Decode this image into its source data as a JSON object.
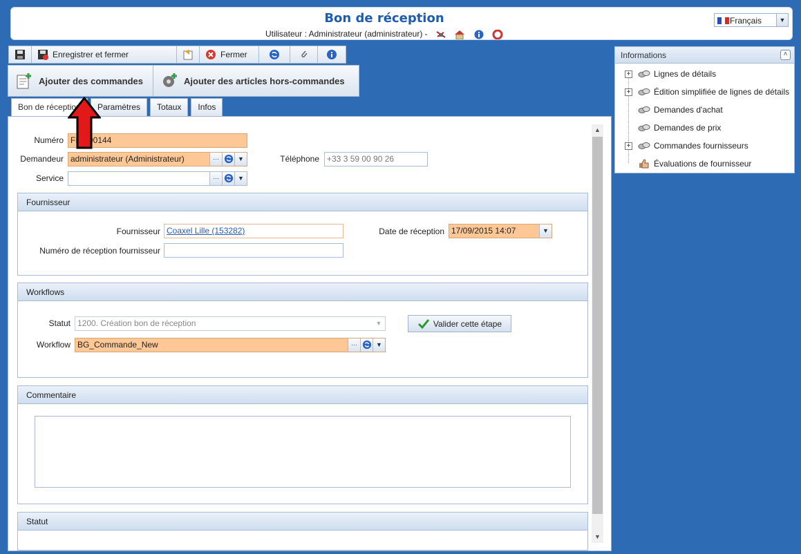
{
  "header": {
    "title": "Bon de réception",
    "user_line": "Utilisateur : Administrateur (administrateur)  -",
    "language": "Français"
  },
  "toolbar1": {
    "save_close": "Enregistrer et fermer",
    "close": "Fermer"
  },
  "toolbar2": {
    "add_orders": "Ajouter des commandes",
    "add_items": "Ajouter des articles hors-commandes"
  },
  "tabs": [
    "Bon de réception",
    "Paramètres",
    "Totaux",
    "Infos"
  ],
  "form": {
    "numero_label": "Numéro",
    "numero_value": "FB2-00144",
    "demandeur_label": "Demandeur",
    "demandeur_value": "administrateur (Administrateur)",
    "telephone_label": "Téléphone",
    "telephone_value": "+33 3 59 00 90 26",
    "service_label": "Service",
    "service_value": ""
  },
  "fournisseur_group": {
    "title": "Fournisseur",
    "fournisseur_label": "Fournisseur",
    "fournisseur_value": "Coaxel Lille (153282)",
    "date_label": "Date de réception",
    "date_value": "17/09/2015 14:07",
    "numrec_label": "Numéro de réception fournisseur",
    "numrec_value": ""
  },
  "workflows_group": {
    "title": "Workflows",
    "statut_label": "Statut",
    "statut_value": "1200. Création bon de réception",
    "validate_button": "Valider cette étape",
    "workflow_label": "Workflow",
    "workflow_value": "BG_Commande_New"
  },
  "comment_group": {
    "title": "Commentaire",
    "value": ""
  },
  "statut_group": {
    "title": "Statut"
  },
  "info_panel": {
    "title": "Informations",
    "items": [
      {
        "label": "Lignes de détails",
        "expandable": true
      },
      {
        "label": "Édition simplifiée de lignes de détails",
        "expandable": true
      },
      {
        "label": "Demandes d'achat",
        "expandable": false
      },
      {
        "label": "Demandes de prix",
        "expandable": false
      },
      {
        "label": "Commandes fournisseurs",
        "expandable": true
      },
      {
        "label": "Évaluations de fournisseur",
        "expandable": false
      }
    ]
  },
  "colors": {
    "accent": "#1e5cb0",
    "required": "#fdc895",
    "background": "#2d6cb4",
    "arrow": "#e31818"
  }
}
